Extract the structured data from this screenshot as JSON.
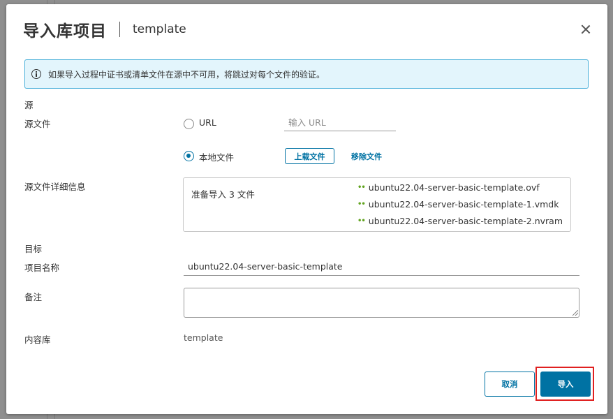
{
  "dialog": {
    "title": "导入库项目",
    "subtitle": "template"
  },
  "alert": {
    "text": "如果导入过程中证书或清单文件在源中不可用，将跳过对每个文件的验证。"
  },
  "source": {
    "section_label": "源",
    "file_label": "源文件",
    "url_option": "URL",
    "url_placeholder": "输入 URL",
    "local_option": "本地文件",
    "upload_button": "上载文件",
    "remove_button": "移除文件",
    "details_label": "源文件详细信息",
    "ready_text": "准备导入 3 文件",
    "files": [
      "ubuntu22.04-server-basic-template.ovf",
      "ubuntu22.04-server-basic-template-1.vmdk",
      "ubuntu22.04-server-basic-template-2.nvram"
    ]
  },
  "target": {
    "section_label": "目标",
    "name_label": "项目名称",
    "name_value": "ubuntu22.04-server-basic-template",
    "notes_label": "备注",
    "library_label": "内容库",
    "library_value": "template"
  },
  "footer": {
    "cancel_label": "取消",
    "import_label": "导入"
  },
  "colors": {
    "accent": "#0072a3",
    "alert_bg": "#e3f5fc",
    "alert_border": "#49afd9",
    "file_ok": "#62a420",
    "highlight": "#e02020"
  }
}
